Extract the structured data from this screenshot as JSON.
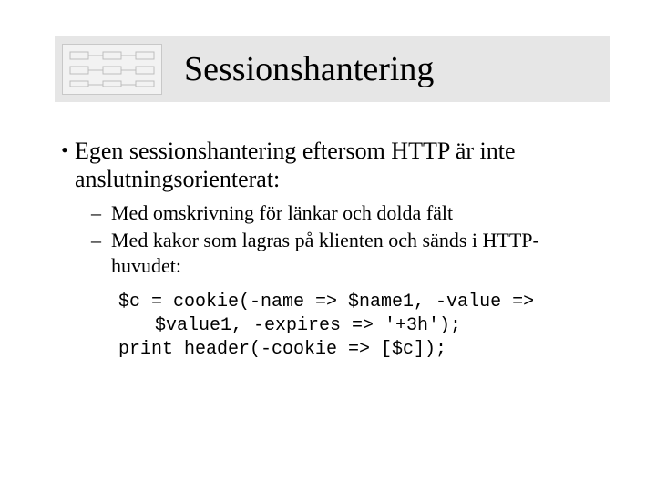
{
  "title": "Sessionshantering",
  "icon_name": "diagram-icon",
  "bullets": {
    "l1": "Egen sessionshantering eftersom HTTP är inte anslutningsorienterat:",
    "sub": [
      "Med omskrivning för länkar och dolda fält",
      "Med kakor som lagras på klienten och sänds i HTTP-huvudet:"
    ]
  },
  "code": [
    "$c = cookie(-name => $name1, -value => $value1, -expires => '+3h');",
    "print header(-cookie => [$c]);"
  ]
}
